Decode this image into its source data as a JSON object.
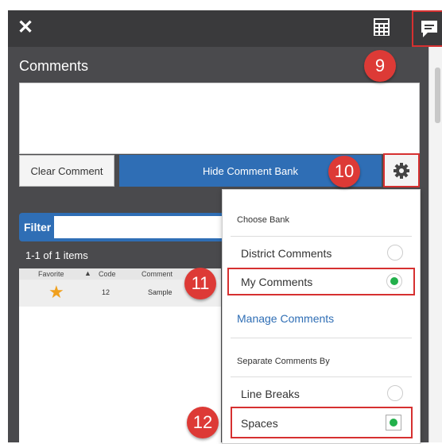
{
  "topbar": {
    "close_glyph": "✕"
  },
  "panel": {
    "title": "Comments",
    "clear_comment": "Clear Comment",
    "hide_comment_bank": "Hide Comment Bank"
  },
  "callouts": {
    "c9": "9",
    "c10": "10",
    "c11": "11",
    "c12": "12"
  },
  "filter": {
    "label": "Filter",
    "value": ""
  },
  "grid": {
    "count": "1-1 of 1 items",
    "headers": {
      "favorite": "Favorite",
      "code": "Code",
      "comment": "Comment"
    },
    "row": {
      "favorite_icon": "★",
      "code": "12",
      "comment": "Sample"
    }
  },
  "dropdown": {
    "choose_bank": "Choose Bank",
    "district_comments": "District Comments",
    "my_comments": "My Comments",
    "manage_comments": "Manage Comments",
    "separate_by": "Separate Comments By",
    "line_breaks": "Line Breaks",
    "spaces": "Spaces"
  },
  "colors": {
    "accent_blue": "#2f6eb5",
    "highlight_red": "#d63030",
    "selected_green": "#22b04b",
    "callout_red": "#dd3a36"
  },
  "icons": [
    "close-icon",
    "calculator-icon",
    "comment-icon",
    "gear-icon",
    "star-icon",
    "sort-up-icon"
  ]
}
